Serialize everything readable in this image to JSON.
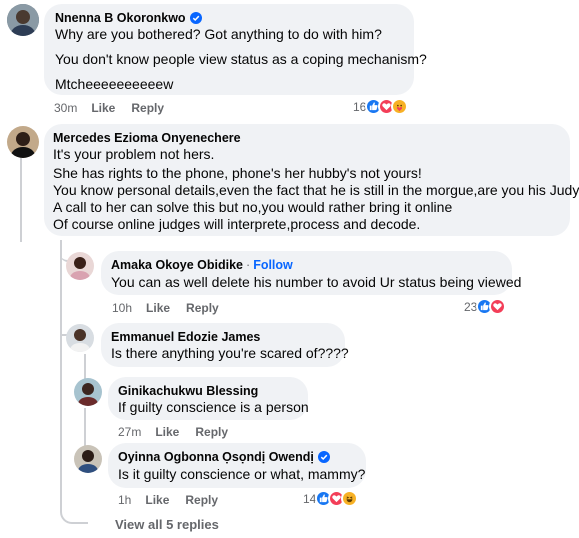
{
  "comments": [
    {
      "author": "Nnenna B Okoronkwo",
      "verified": true,
      "lines": [
        "Why are you bothered? Got anything to do with him?",
        "You don't know people view status as a coping mechanism?",
        "Mtcheeeeeeeeeew"
      ],
      "time": "30m",
      "like_label": "Like",
      "reply_label": "Reply",
      "reaction_count": "16",
      "reactions": [
        "like-icon",
        "love-icon",
        "care-icon"
      ]
    },
    {
      "author": "Mercedes Ezioma Onyenechere",
      "verified": false,
      "lines": [
        "It's your problem not hers.",
        "She has rights to the phone, phone's her hubby's not yours!",
        "You know personal details,even the fact that he is still in the morgue,are you his Judy?",
        "A call to her can solve this but no,you would rather bring it online",
        "Of course online judges will interprete,process and decode."
      ]
    }
  ],
  "replies": [
    {
      "author": "Amaka Okoye Obidike",
      "separator": "·",
      "follow_label": "Follow",
      "lines": [
        "You can as well delete his number to avoid Ur status being viewed"
      ],
      "time": "10h",
      "like_label": "Like",
      "reply_label": "Reply",
      "reaction_count": "23",
      "reactions": [
        "like-icon",
        "love-icon"
      ]
    },
    {
      "author": "Emmanuel Edozie James",
      "lines": [
        "Is there anything you're scared of????"
      ]
    },
    {
      "author": "Ginikachukwu Blessing",
      "lines": [
        "If guilty conscience is a person"
      ],
      "time": "27m",
      "like_label": "Like",
      "reply_label": "Reply"
    },
    {
      "author": "Oyinna Ogbonna Ọsọndị Owendị",
      "verified": true,
      "lines": [
        "Is it guilty conscience or what, mammy?"
      ],
      "time": "1h",
      "like_label": "Like",
      "reply_label": "Reply",
      "reaction_count": "14",
      "reactions": [
        "like-icon",
        "love-icon",
        "haha-icon"
      ]
    }
  ],
  "view_all_label": "View all 5 replies",
  "colors": {
    "bubble": "#f0f2f5",
    "meta_text": "#65676b",
    "verified": "#0866ff",
    "like": "#1877f2",
    "love": "#f33e58",
    "care_haha": "#f7b125",
    "thread_line": "#ced0d4"
  }
}
